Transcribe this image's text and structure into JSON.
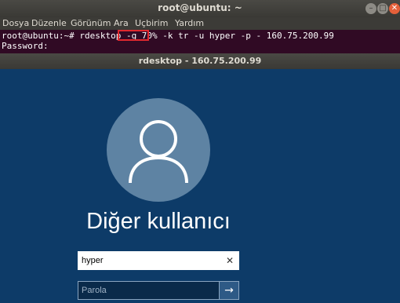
{
  "terminal": {
    "title": "root@ubuntu: ~",
    "menu": [
      "Dosya",
      "Düzenle",
      "Görünüm",
      "Ara",
      "Uçbirim",
      "Yardım"
    ],
    "prompt_line": "root@ubuntu:~# rdesktop -g 70% -k tr -u hyper -p - 160.75.200.99",
    "password_line": "Password:",
    "highlight_color": "#e0282e",
    "window_controls": [
      "minimize-icon",
      "maximize-icon",
      "close-icon"
    ]
  },
  "rdesktop": {
    "title": "rdesktop - 160.75.200.99",
    "login": {
      "username_label": "Diğer kullanıcı",
      "username_value": "hyper",
      "password_placeholder": "Parola",
      "clear_glyph": "✕",
      "submit_glyph": "→",
      "avatar_icon": "user-avatar-icon"
    },
    "colors": {
      "background": "#0d3b68",
      "avatar": "#5e83a3"
    }
  }
}
